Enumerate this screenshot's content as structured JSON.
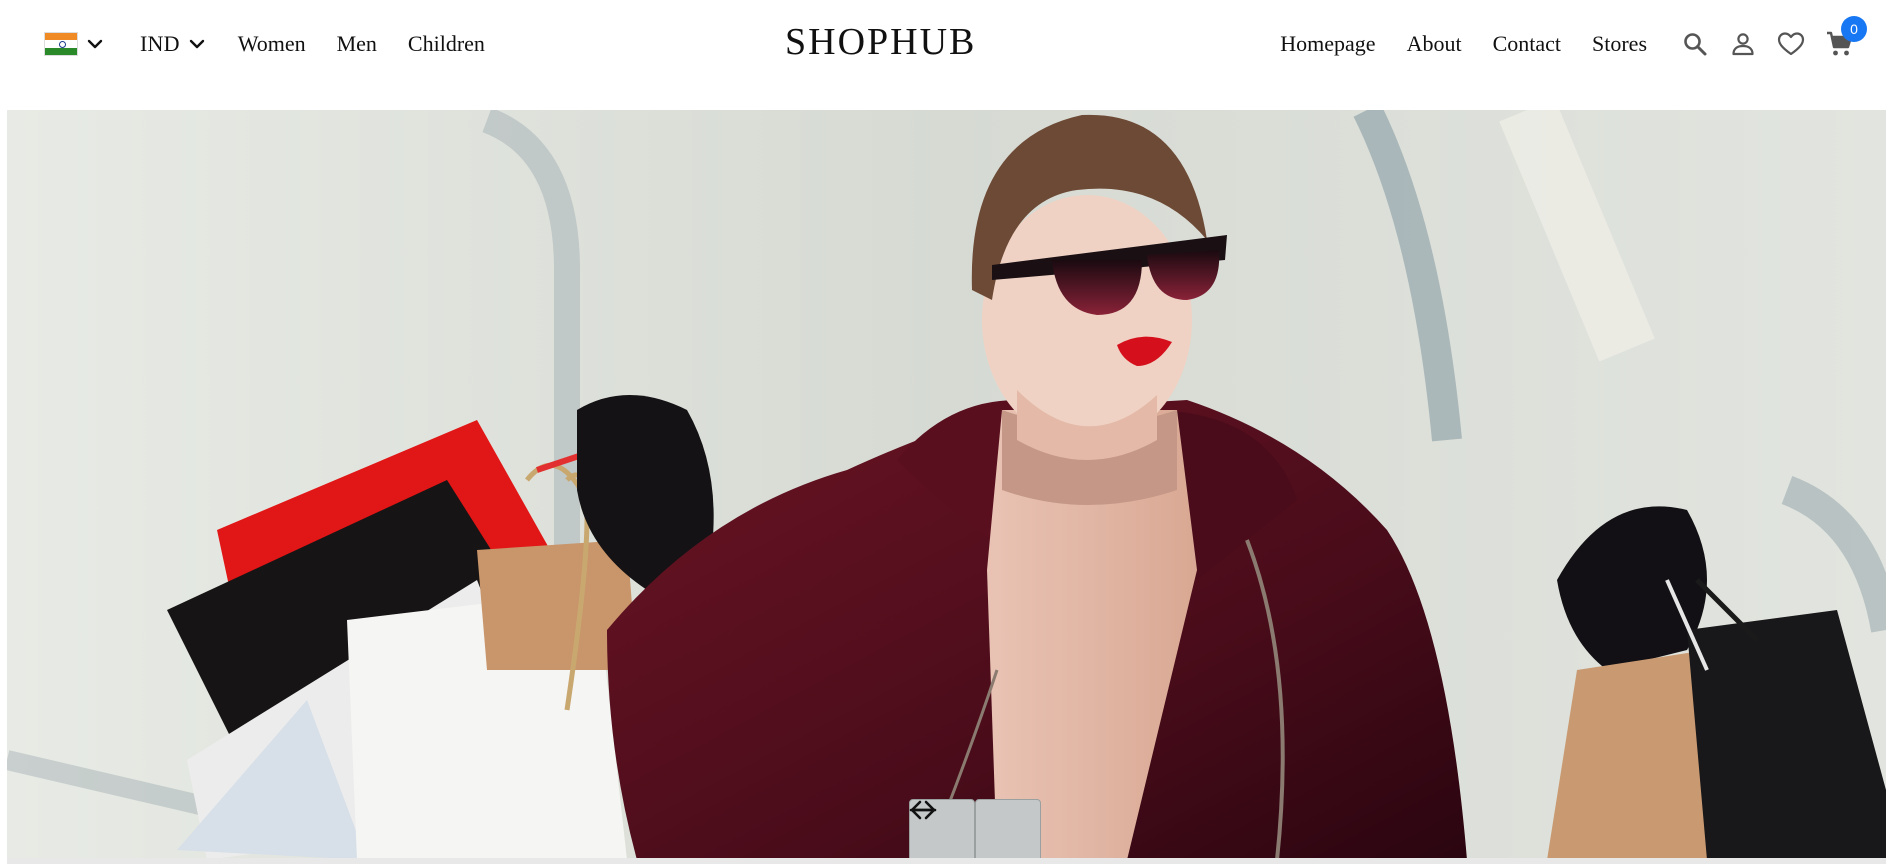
{
  "header": {
    "locale": {
      "flag_icon": "india-flag-icon",
      "currency_label": "IND"
    },
    "nav_left": [
      {
        "label": "Women"
      },
      {
        "label": "Men"
      },
      {
        "label": "Children"
      }
    ],
    "logo": "SHOPHUB",
    "nav_right": [
      {
        "label": "Homepage"
      },
      {
        "label": "About"
      },
      {
        "label": "Contact"
      },
      {
        "label": "Stores"
      }
    ],
    "icons": [
      "search-icon",
      "user-icon",
      "heart-icon",
      "cart-icon"
    ],
    "cart_count": "0"
  },
  "hero": {
    "image": "woman-with-shopping-bags"
  },
  "colors": {
    "accent": "#1877f2",
    "coat": "#5a1020",
    "arrow_bg": "#c4c8c8"
  }
}
